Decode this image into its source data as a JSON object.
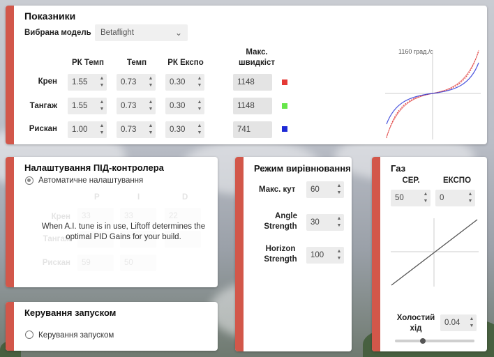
{
  "rates": {
    "title": "Показники",
    "model_label": "Вибрана модель",
    "model_value": "Betaflight",
    "col_rc_rate": "РК Темп",
    "col_rate": "Темп",
    "col_rc_expo": "РК Експо",
    "col_max_speed_1": "Макс.",
    "col_max_speed_2": "швидкіст",
    "rows": [
      {
        "name": "Крен",
        "rc_rate": "1.55",
        "rate": "0.73",
        "rc_expo": "0.30",
        "max": "1148",
        "color": "#e53935"
      },
      {
        "name": "Тангаж",
        "rc_rate": "1.55",
        "rate": "0.73",
        "rc_expo": "0.30",
        "max": "1148",
        "color": "#66e64a"
      },
      {
        "name": "Рискан",
        "rc_rate": "1.00",
        "rate": "0.73",
        "rc_expo": "0.30",
        "max": "741",
        "color": "#1e2ad6"
      }
    ],
    "graph_label": "1160 град./с"
  },
  "pid": {
    "title": "Налаштування ПІД-контролера",
    "auto_label": "Автоматичне налаштування",
    "auto_selected": true,
    "col_p": "P",
    "col_i": "I",
    "col_d": "D",
    "row_roll": "Крен",
    "row_pitch": "Тангаж",
    "row_yaw": "Рискан",
    "faded_p_roll": "33",
    "faded_i_roll": "33",
    "faded_d_roll": "22",
    "faded_p_yaw": "59",
    "faded_i_yaw": "50",
    "notice_1": "When A.I. tune is in use, Liftoff determines the",
    "notice_2": "optimal PID Gains for your build."
  },
  "launch": {
    "title": "Керування запуском",
    "option_label": "Керування запуском",
    "option_selected": false
  },
  "level": {
    "title": "Режим вирівнювання",
    "max_angle_label": "Макс. кут",
    "max_angle_value": "60",
    "angle_strength_1": "Angle",
    "angle_strength_2": "Strength",
    "angle_strength_value": "30",
    "horizon_strength_1": "Horizon",
    "horizon_strength_2": "Strength",
    "horizon_strength_value": "100"
  },
  "throttle": {
    "title": "Газ",
    "mid_label": "СЕР.",
    "expo_label": "ЕКСПО",
    "mid_value": "50",
    "expo_value": "0",
    "idle_label_1": "Холостий",
    "idle_label_2": "хід",
    "idle_value": "0.04",
    "slider_fraction": 0.35
  },
  "icons": {
    "spin_up": "▲",
    "spin_down": "▼",
    "chevron": "⌄"
  }
}
